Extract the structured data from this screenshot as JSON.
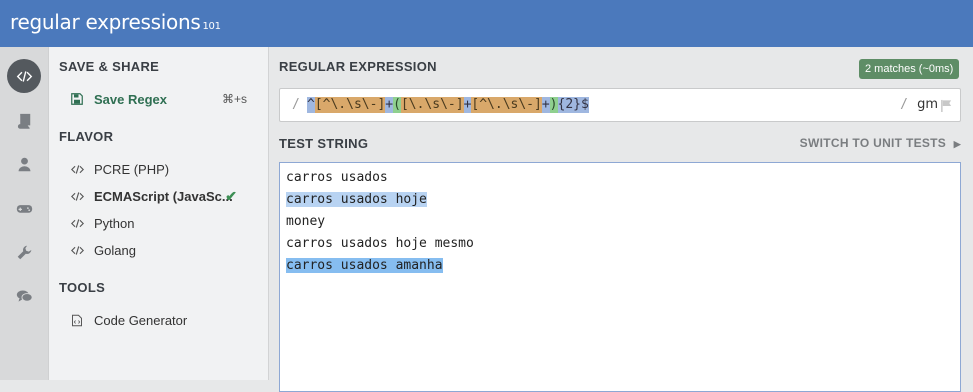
{
  "app": {
    "logo_main": "regular expressions",
    "logo_sub": "101"
  },
  "iconbar": [
    {
      "icon": "code-icon",
      "active": true
    },
    {
      "icon": "book-icon",
      "active": false
    },
    {
      "icon": "user-icon",
      "active": false
    },
    {
      "icon": "gamepad-icon",
      "active": false
    },
    {
      "icon": "wrench-icon",
      "active": false
    },
    {
      "icon": "chat-icon",
      "active": false
    }
  ],
  "sidebar": {
    "save_share": "SAVE & SHARE",
    "save_regex": "Save Regex",
    "save_shortcut": "⌘+s",
    "flavor_title": "FLAVOR",
    "flavors": [
      "PCRE (PHP)",
      "ECMAScript (JavaSc...",
      "Python",
      "Golang"
    ],
    "selected_flavor": 1,
    "tools_title": "TOOLS",
    "tools": [
      "Code Generator"
    ]
  },
  "regex_panel": {
    "label": "REGULAR EXPRESSION",
    "matches_badge": "2 matches (~0ms)",
    "open_delim": "/",
    "tokens": [
      {
        "t": "^",
        "k": "anchor"
      },
      {
        "t": "[^\\.\\s\\-]",
        "k": "set"
      },
      {
        "t": "+",
        "k": "quant"
      },
      {
        "t": "(",
        "k": "group"
      },
      {
        "t": "[\\.\\s\\-]",
        "k": "set"
      },
      {
        "t": "+",
        "k": "quant"
      },
      {
        "t": "[^\\.\\s\\-]",
        "k": "set"
      },
      {
        "t": "+",
        "k": "quant"
      },
      {
        "t": ")",
        "k": "group"
      },
      {
        "t": "{2}",
        "k": "quant"
      },
      {
        "t": "$",
        "k": "anchor"
      }
    ],
    "close_delim": "/",
    "flags": "gm"
  },
  "test_panel": {
    "label": "TEST STRING",
    "switch_label": "SWITCH TO UNIT TESTS",
    "lines": [
      {
        "text": "carros usados",
        "match": 0
      },
      {
        "text": "carros usados hoje",
        "match": 1
      },
      {
        "text": "money",
        "match": 0
      },
      {
        "text": "carros usados hoje mesmo",
        "match": 0
      },
      {
        "text": "carros usados amanha",
        "match": 2
      }
    ]
  },
  "colors": {
    "accent": "#4b79bc",
    "badge": "#5e8d66",
    "match1": "#b8d3f2",
    "match2": "#86bdf0"
  }
}
